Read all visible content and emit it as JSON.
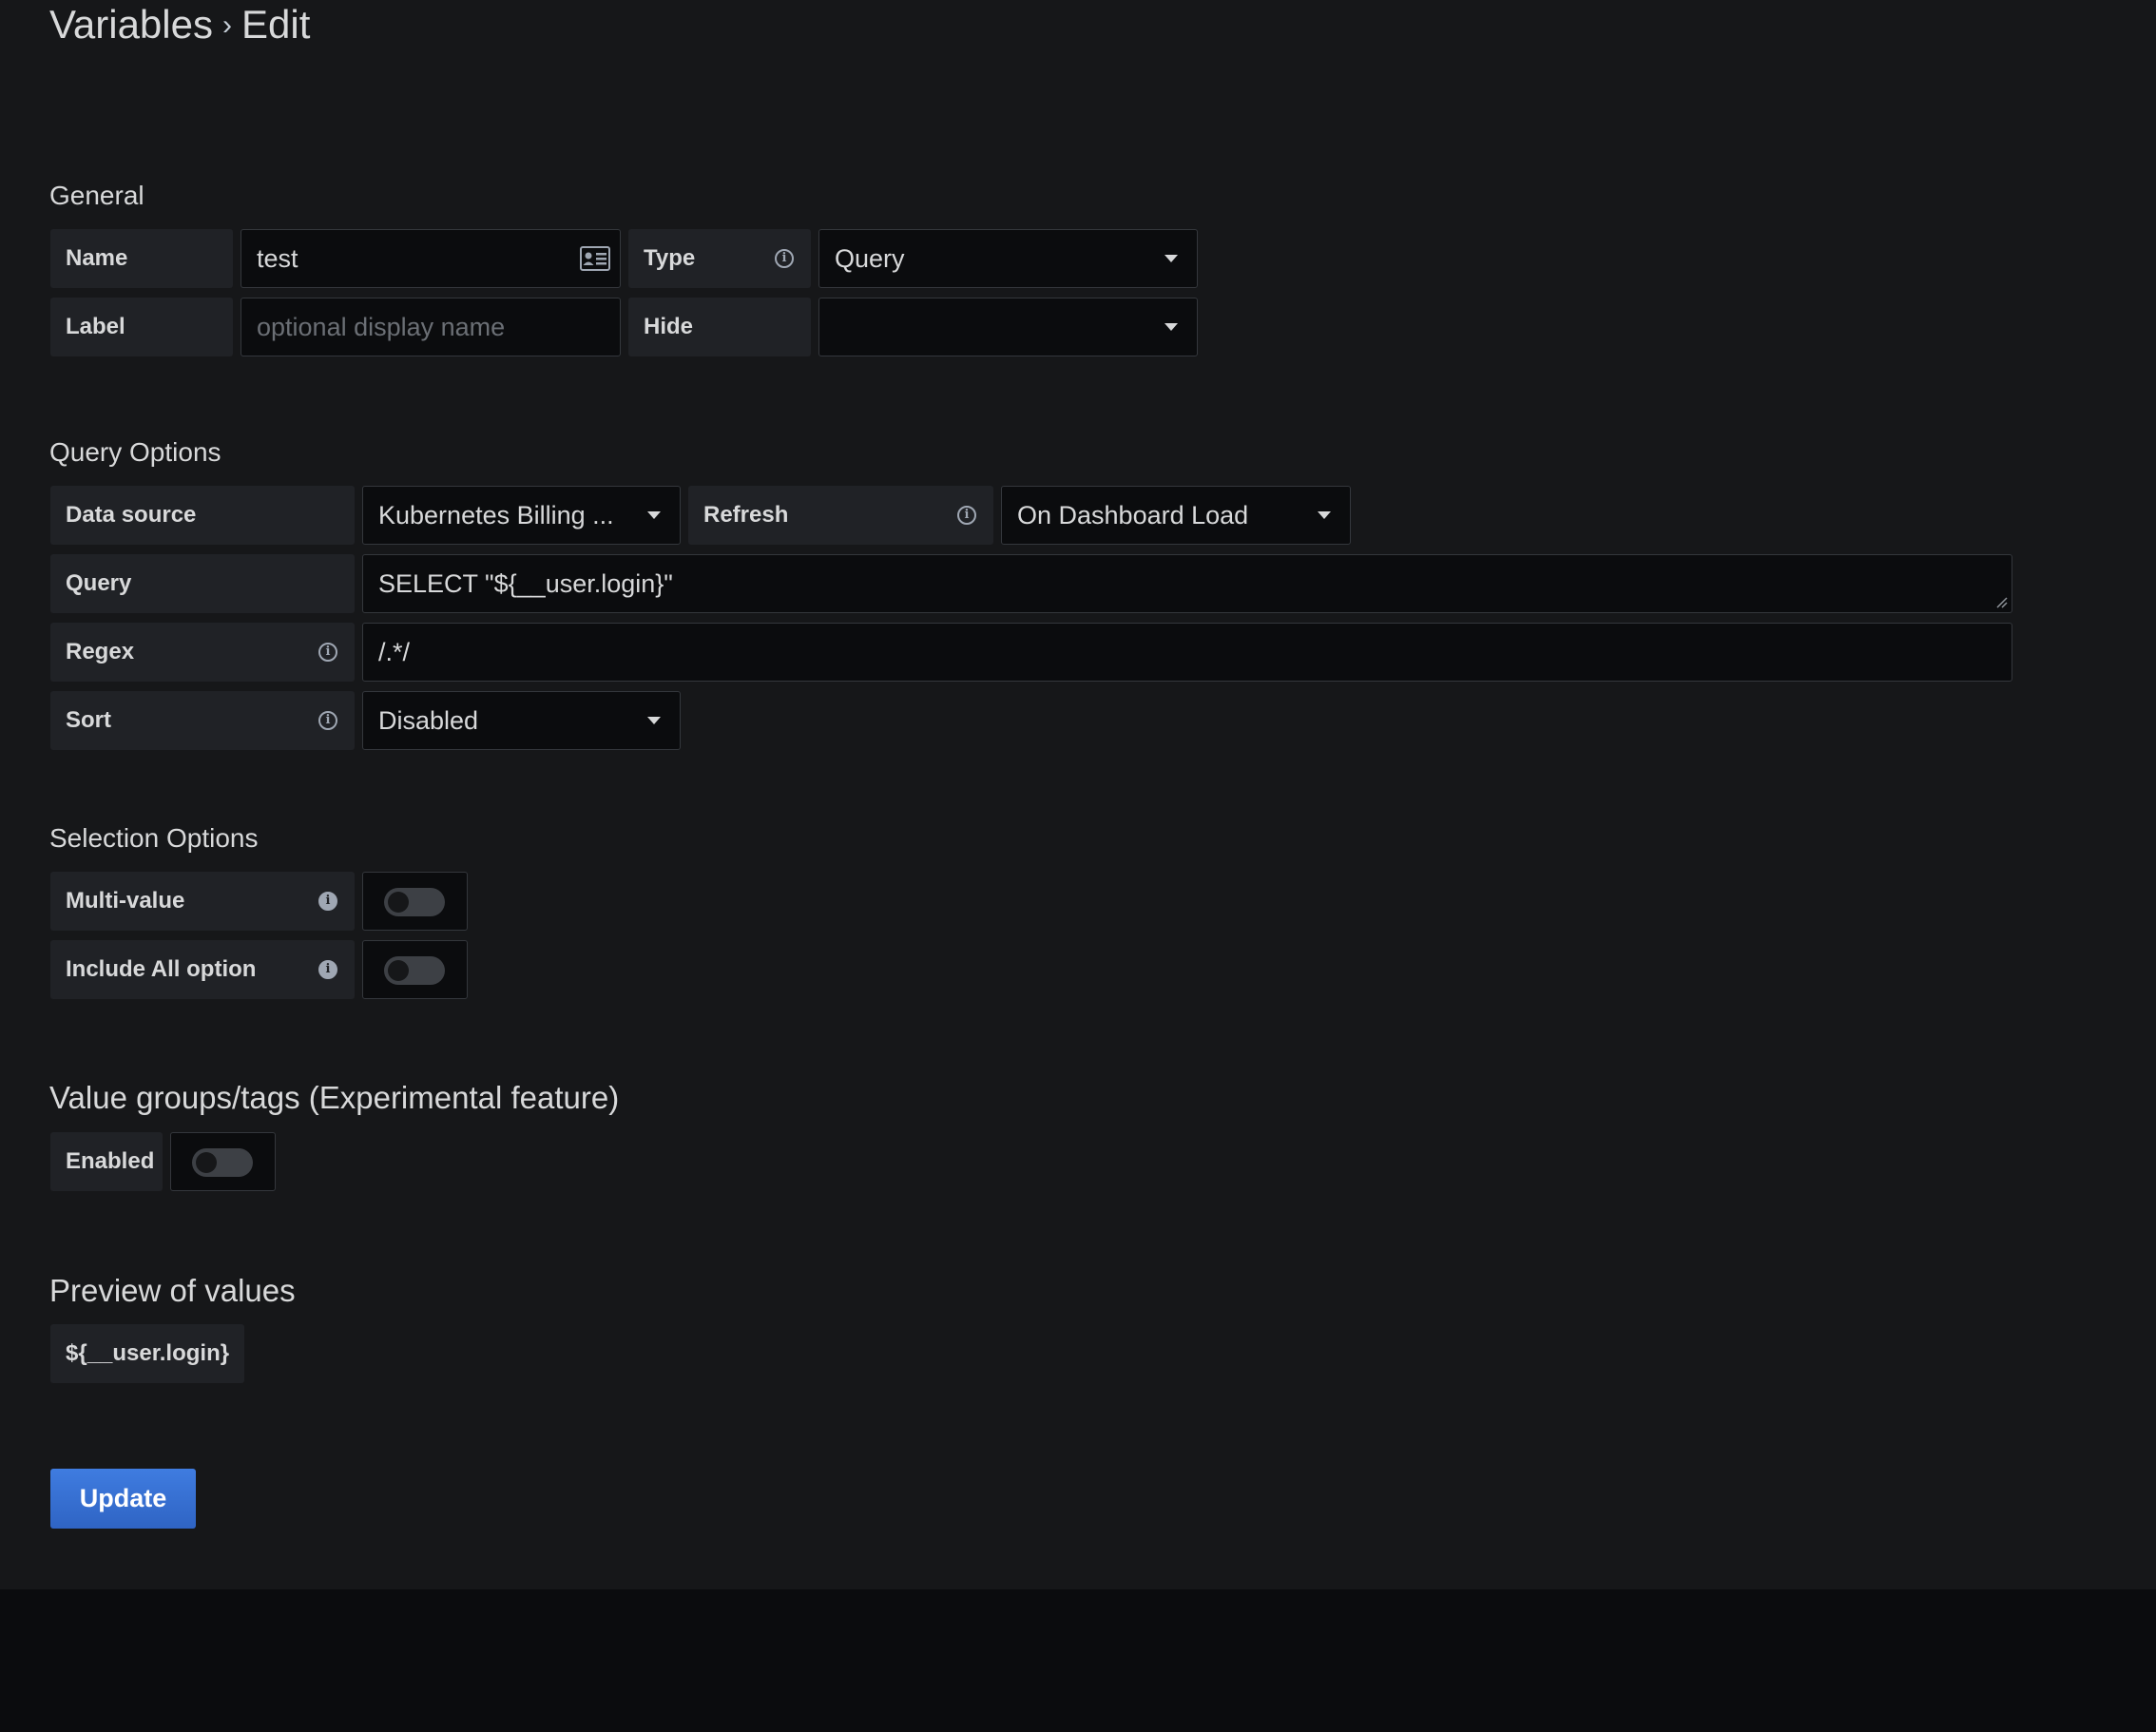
{
  "header": {
    "title_main": "Variables",
    "title_sep": "›",
    "title_sub": "Edit"
  },
  "general": {
    "title": "General",
    "name_label": "Name",
    "name_value": "test",
    "type_label": "Type",
    "type_value": "Query",
    "label_label": "Label",
    "label_placeholder": "optional display name",
    "hide_label": "Hide",
    "hide_value": ""
  },
  "query_options": {
    "title": "Query Options",
    "datasource_label": "Data source",
    "datasource_value": "Kubernetes Billing ...",
    "refresh_label": "Refresh",
    "refresh_value": "On Dashboard Load",
    "query_label": "Query",
    "query_value": "SELECT \"${__user.login}\"",
    "regex_label": "Regex",
    "regex_value": "/.*/",
    "sort_label": "Sort",
    "sort_value": "Disabled"
  },
  "selection_options": {
    "title": "Selection Options",
    "multi_value_label": "Multi-value",
    "multi_value_on": false,
    "include_all_label": "Include All option",
    "include_all_on": false
  },
  "value_groups": {
    "title": "Value groups/tags (Experimental feature)",
    "enabled_label": "Enabled",
    "enabled_on": false
  },
  "preview": {
    "title": "Preview of values",
    "values": [
      "${__user.login}"
    ]
  },
  "actions": {
    "update_label": "Update"
  },
  "icons": {
    "info": "info-circle-icon",
    "info_filled": "info-filled-icon",
    "dropdown": "caret-down-icon",
    "id_card": "id-card-icon",
    "resize": "resize-grip-icon"
  },
  "colors": {
    "panel_bg": "#161719",
    "page_bg": "#0b0c0e",
    "label_bg": "#202226",
    "input_bg": "#0b0c0e",
    "border": "#34373c",
    "text": "#d8d9da",
    "primary_button": "#3274d9"
  }
}
